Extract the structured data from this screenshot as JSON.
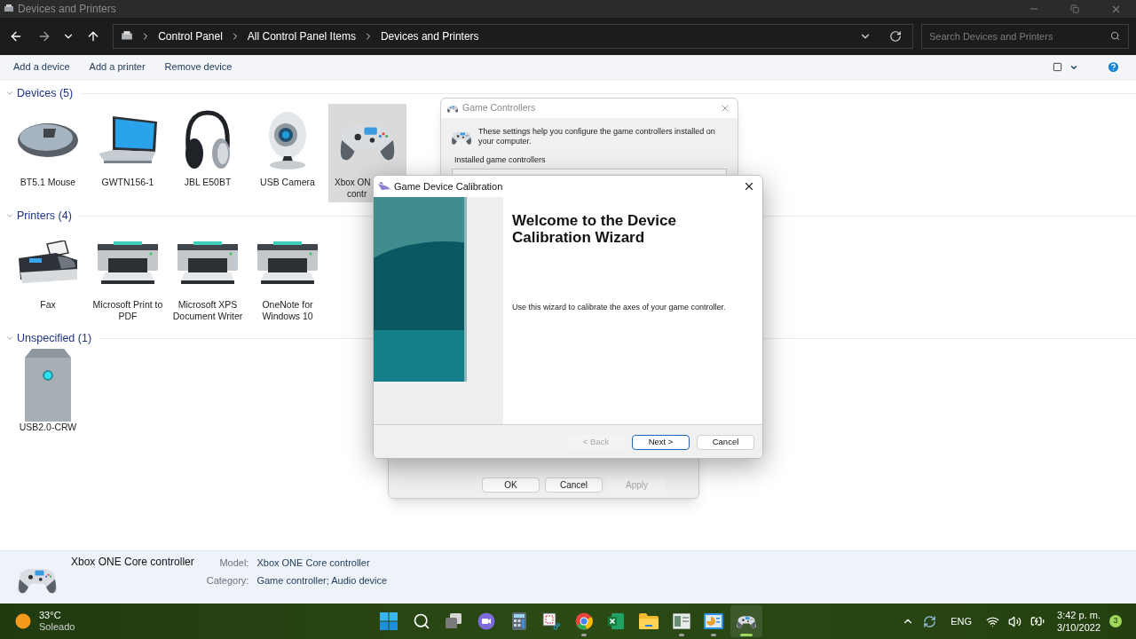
{
  "window": {
    "title": "Devices and Printers"
  },
  "address": {
    "breadcrumb": [
      "Control Panel",
      "All Control Panel Items",
      "Devices and Printers"
    ]
  },
  "search": {
    "placeholder": "Search Devices and Printers"
  },
  "commands": [
    "Add a device",
    "Add a printer",
    "Remove device"
  ],
  "groups": [
    {
      "title": "Devices (5)",
      "expanded": true,
      "items": [
        {
          "kind": "mouse",
          "label": [
            "BT5.1 Mouse"
          ],
          "selected": false
        },
        {
          "kind": "laptop",
          "label": [
            "GWTN156-1"
          ],
          "selected": false
        },
        {
          "kind": "headphones",
          "label": [
            "JBL E50BT"
          ],
          "selected": false
        },
        {
          "kind": "webcam",
          "label": [
            "USB Camera"
          ],
          "selected": false
        },
        {
          "kind": "gamepad",
          "label": [
            "Xbox ON",
            "contr"
          ],
          "selected": true
        }
      ]
    },
    {
      "title": "Printers (4)",
      "expanded": true,
      "items": [
        {
          "kind": "fax",
          "label": [
            "Fax"
          ],
          "selected": false
        },
        {
          "kind": "printer",
          "label": [
            "Microsoft Print to",
            "PDF"
          ],
          "selected": false
        },
        {
          "kind": "printer",
          "label": [
            "Microsoft XPS",
            "Document Writer"
          ],
          "selected": false
        },
        {
          "kind": "printer",
          "label": [
            "OneNote for",
            "Windows 10"
          ],
          "selected": false
        }
      ]
    },
    {
      "title": "Unspecified (1)",
      "expanded": true,
      "items": [
        {
          "kind": "drive",
          "label": [
            "USB2.0-CRW"
          ],
          "selected": false
        }
      ]
    }
  ],
  "details": {
    "name": "Xbox ONE Core controller",
    "fields": [
      {
        "label": "Model:",
        "value": "Xbox ONE Core controller"
      },
      {
        "label": "Category:",
        "value": "Game controller; Audio device"
      }
    ]
  },
  "game_controllers": {
    "title": "Game Controllers",
    "description": "These settings help you configure the game controllers installed on your computer.",
    "list_label": "Installed game controllers"
  },
  "properties_buttons": [
    {
      "label": "OK",
      "disabled": false
    },
    {
      "label": "Cancel",
      "disabled": false
    },
    {
      "label": "Apply",
      "disabled": true
    }
  ],
  "wizard": {
    "title": "Game Device Calibration",
    "heading": "Welcome to the Device Calibration Wizard",
    "body": "Use this wizard to calibrate the axes of your game controller.",
    "buttons": [
      {
        "label": "< Back",
        "disabled": true,
        "default": false
      },
      {
        "label": "Next >",
        "disabled": false,
        "default": true
      },
      {
        "label": "Cancel",
        "disabled": false,
        "default": false
      }
    ]
  },
  "taskbar": {
    "weather": {
      "temperature": "33°C",
      "condition": "Soleado"
    },
    "apps": [
      {
        "kind": "start",
        "running": false,
        "selected": false
      },
      {
        "kind": "search",
        "running": false,
        "selected": false
      },
      {
        "kind": "taskview",
        "running": false,
        "selected": false
      },
      {
        "kind": "chat",
        "running": false,
        "selected": false
      },
      {
        "kind": "calculator",
        "running": false,
        "selected": false
      },
      {
        "kind": "snip",
        "running": false,
        "selected": false
      },
      {
        "kind": "chrome",
        "running": true,
        "selected": false
      },
      {
        "kind": "excel",
        "running": false,
        "selected": false
      },
      {
        "kind": "folder",
        "running": false,
        "selected": false
      },
      {
        "kind": "window",
        "running": true,
        "selected": false
      },
      {
        "kind": "chart",
        "running": true,
        "selected": false
      },
      {
        "kind": "gamepad",
        "running": true,
        "selected": true
      }
    ],
    "tray": {
      "language": "ENG",
      "time": "3:42 p. m.",
      "date": "3/10/2022",
      "notifications": "3"
    }
  }
}
